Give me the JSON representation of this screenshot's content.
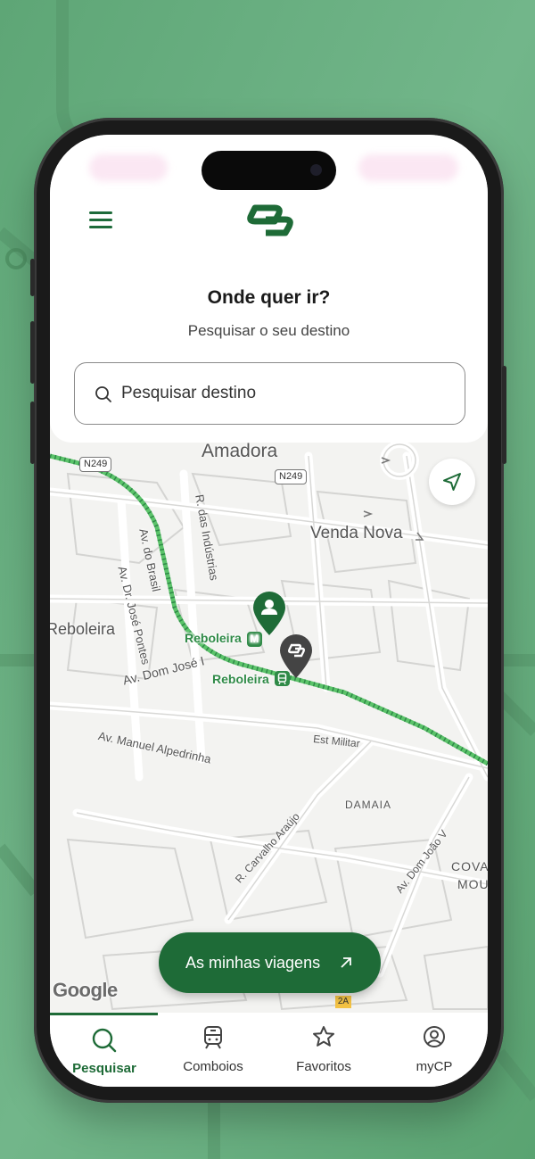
{
  "header": {
    "title": "Onde quer ir?",
    "subtitle": "Pesquisar o seu destino",
    "search_placeholder": "Pesquisar destino",
    "search_value": ""
  },
  "map": {
    "labels": {
      "amadora": "Amadora",
      "venda_nova": "Venda Nova",
      "reboleira_area": "Reboleira",
      "av_do_brasil": "Av. do Brasil",
      "r_das_industrias": "R. das Indústrias",
      "av_dr_jose_pontes": "Av. Dr. José Pontes",
      "av_dom_jose": "Av. Dom José I",
      "av_manuel_alpedrinha": "Av. Manuel Alpedrinha",
      "est_militar": "Est Militar",
      "damaia": "DAMAIA",
      "r_carvalho_araujo": "R. Carvalho Araújo",
      "av_dom_joao_v": "Av. Dom João V",
      "cova_1": "COVA",
      "cova_2": "MOU"
    },
    "road_signs": {
      "n249_a": "N249",
      "n249_b": "N249",
      "exit_2a": "2A"
    },
    "stations": {
      "metro": {
        "name": "Reboleira",
        "badge": "M"
      },
      "train": {
        "name": "Reboleira"
      }
    },
    "attribution": "Google"
  },
  "trips_button": {
    "label": "As minhas viagens"
  },
  "tabs": [
    {
      "label": "Pesquisar",
      "icon": "search-icon",
      "active": true
    },
    {
      "label": "Comboios",
      "icon": "train-icon",
      "active": false
    },
    {
      "label": "Favoritos",
      "icon": "star-icon",
      "active": false
    },
    {
      "label": "myCP",
      "icon": "user-circle-icon",
      "active": false
    }
  ],
  "colors": {
    "brand_green": "#1e6b37",
    "rail_green": "#5bc36a",
    "background": "#6aae82"
  }
}
